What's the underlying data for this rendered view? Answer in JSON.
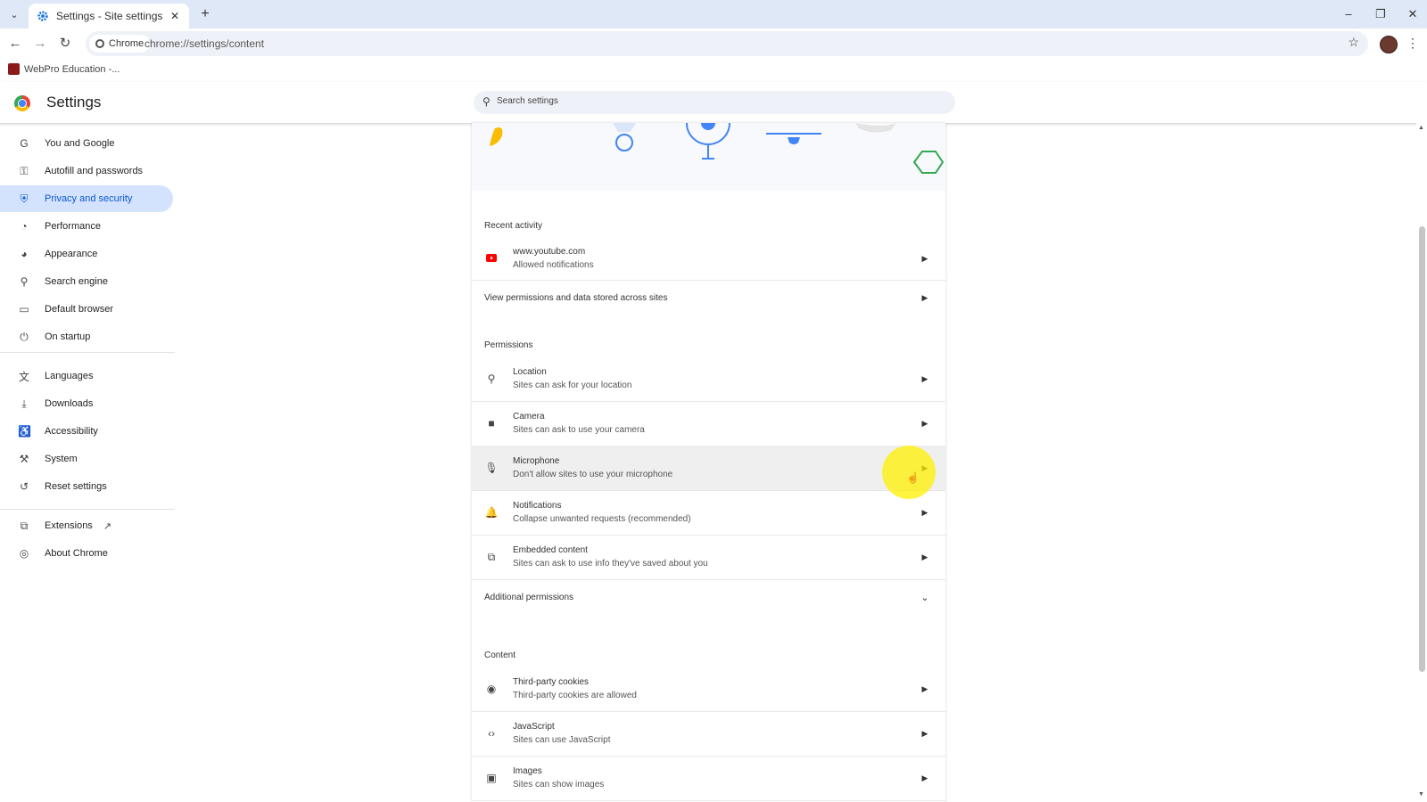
{
  "browser": {
    "tab_title": "Settings - Site settings",
    "omnibox_chip": "Chrome",
    "url": "chrome://settings/content",
    "bookmark": "WebPro Education -...",
    "window_controls": [
      "–",
      "❐",
      "✕"
    ]
  },
  "header": {
    "title": "Settings",
    "search_placeholder": "Search settings"
  },
  "sidebar": {
    "items": [
      {
        "label": "You and Google",
        "icon": "google-g-icon",
        "glyph": "G"
      },
      {
        "label": "Autofill and passwords",
        "icon": "key-icon",
        "glyph": "⚿"
      },
      {
        "label": "Privacy and security",
        "icon": "shield-icon",
        "glyph": "⛨"
      },
      {
        "label": "Performance",
        "icon": "speedometer-icon",
        "glyph": "◔"
      },
      {
        "label": "Appearance",
        "icon": "palette-icon",
        "glyph": "◕"
      },
      {
        "label": "Search engine",
        "icon": "search-icon",
        "glyph": "⚲"
      },
      {
        "label": "Default browser",
        "icon": "browser-window-icon",
        "glyph": "▭"
      },
      {
        "label": "On startup",
        "icon": "power-icon",
        "glyph": "⏻"
      },
      {
        "label": "Languages",
        "icon": "translate-icon",
        "glyph": "文"
      },
      {
        "label": "Downloads",
        "icon": "download-icon",
        "glyph": "⤓"
      },
      {
        "label": "Accessibility",
        "icon": "accessibility-icon",
        "glyph": "♿"
      },
      {
        "label": "System",
        "icon": "wrench-icon",
        "glyph": "⚒"
      },
      {
        "label": "Reset settings",
        "icon": "reset-icon",
        "glyph": "↺"
      },
      {
        "label": "Extensions",
        "icon": "puzzle-icon",
        "glyph": "⧉"
      },
      {
        "label": "About Chrome",
        "icon": "chrome-icon",
        "glyph": "◎"
      }
    ],
    "active_index": 2
  },
  "main": {
    "recent_activity_title": "Recent activity",
    "recent": [
      {
        "title": "www.youtube.com",
        "subtitle": "Allowed notifications"
      }
    ],
    "view_permissions": "View permissions and data stored across sites",
    "permissions_title": "Permissions",
    "permissions": [
      {
        "title": "Location",
        "subtitle": "Sites can ask for your location",
        "icon": "location-pin-icon",
        "glyph": "⚲"
      },
      {
        "title": "Camera",
        "subtitle": "Sites can ask to use your camera",
        "icon": "camera-icon",
        "glyph": "■"
      },
      {
        "title": "Microphone",
        "subtitle": "Don't allow sites to use your microphone",
        "icon": "microphone-icon",
        "glyph": "🎙"
      },
      {
        "title": "Notifications",
        "subtitle": "Collapse unwanted requests (recommended)",
        "icon": "bell-icon",
        "glyph": "🔔"
      },
      {
        "title": "Embedded content",
        "subtitle": "Sites can ask to use info they've saved about you",
        "icon": "embedded-content-icon",
        "glyph": "⧉"
      }
    ],
    "additional_permissions": "Additional permissions",
    "content_title": "Content",
    "content": [
      {
        "title": "Third-party cookies",
        "subtitle": "Third-party cookies are allowed",
        "icon": "cookie-icon",
        "glyph": "◉"
      },
      {
        "title": "JavaScript",
        "subtitle": "Sites can use JavaScript",
        "icon": "code-icon",
        "glyph": "‹›"
      },
      {
        "title": "Images",
        "subtitle": "Sites can show images",
        "icon": "image-icon",
        "glyph": "▣"
      }
    ]
  },
  "colors": {
    "accent": "#0b57d0",
    "active_nav_bg": "#d3e3fd",
    "tabstrip_bg": "#dfe8f6",
    "youtube_red": "#ff0000",
    "cursor_highlight": "#fff000"
  }
}
